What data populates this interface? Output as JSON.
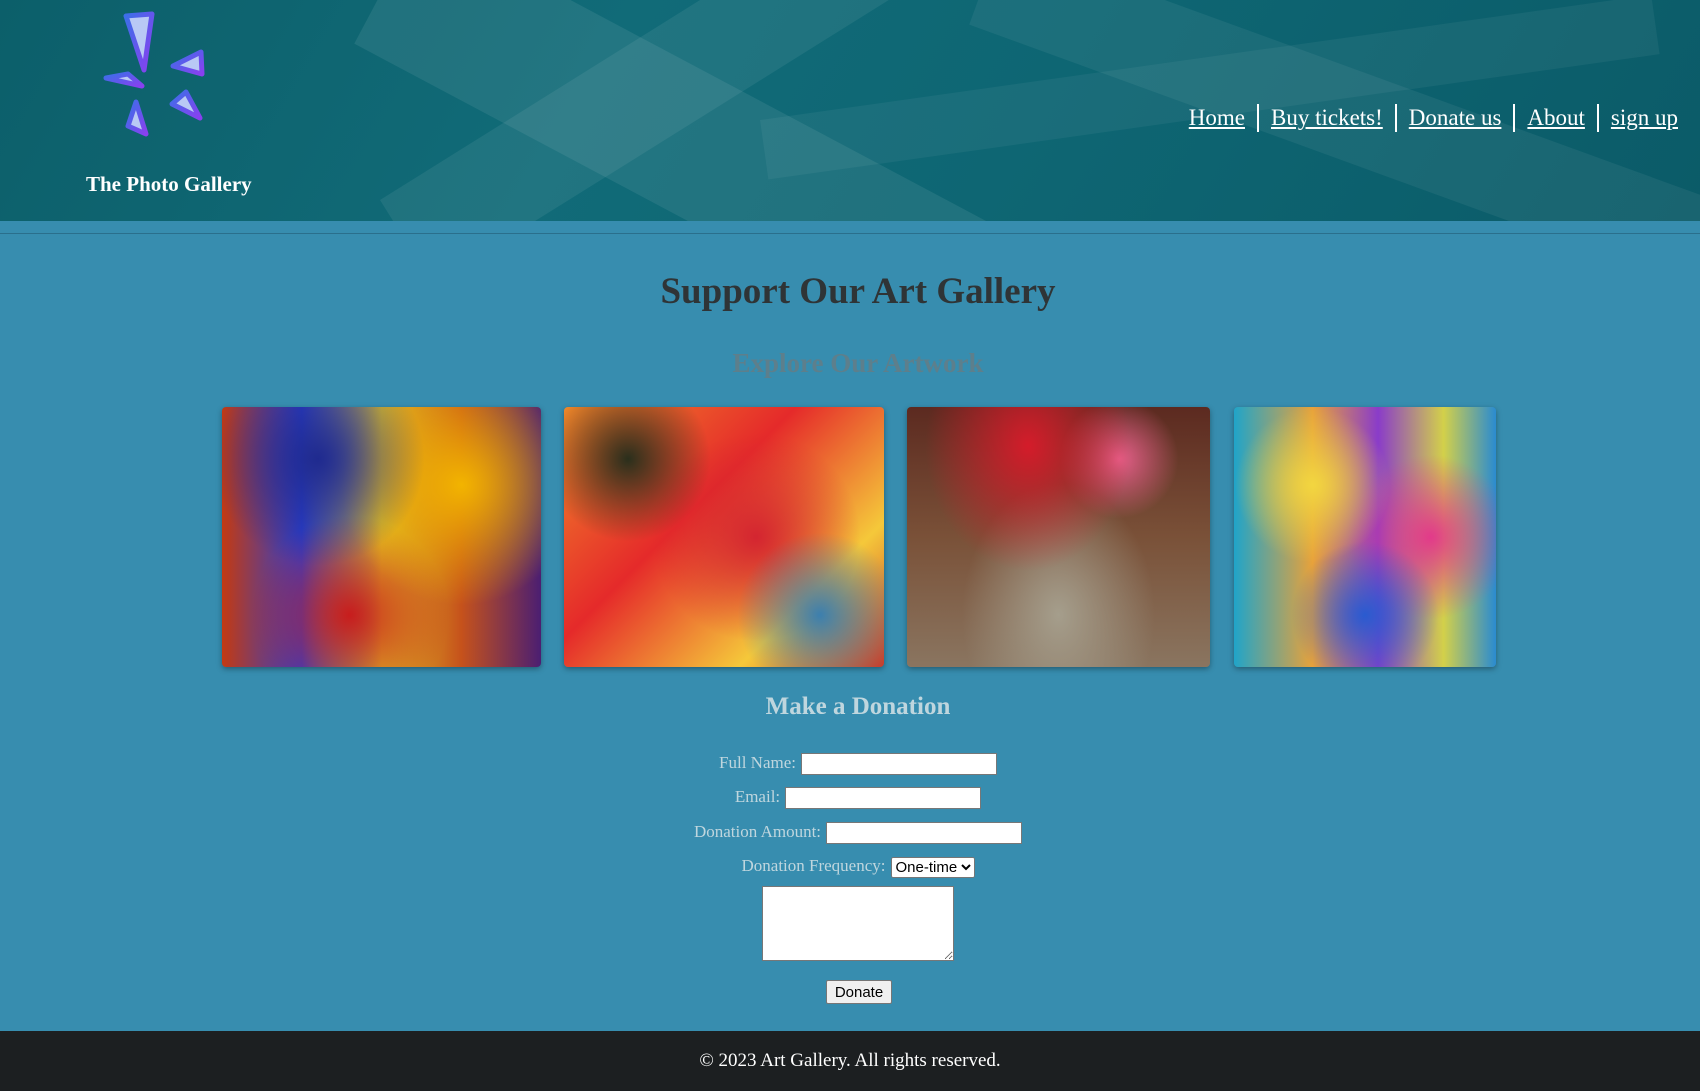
{
  "header": {
    "site_title": "The Photo Gallery",
    "logo_icon": "pinwheel-logo-icon",
    "nav": [
      {
        "label": "Home"
      },
      {
        "label": "Buy tickets!"
      },
      {
        "label": "Donate us"
      },
      {
        "label": "About"
      },
      {
        "label": "sign up"
      }
    ]
  },
  "main": {
    "title": "Support Our Art Gallery",
    "gallery_heading": "Explore Our Artwork",
    "donation_heading": "Make a Donation"
  },
  "form": {
    "full_name_label": "Full Name:",
    "full_name_value": "",
    "email_label": "Email:",
    "email_value": "",
    "amount_label": "Donation Amount:",
    "amount_value": "",
    "frequency_label": "Donation Frequency:",
    "frequency_selected": "One-time",
    "message_value": "",
    "donate_button": "Donate"
  },
  "footer": {
    "text": "© 2023 Art Gallery. All rights reserved."
  },
  "colors": {
    "header_bg": "#0e6673",
    "page_bg": "#378daf",
    "footer_bg": "#1c1f21",
    "logo_stroke": "#7b3fe4"
  }
}
